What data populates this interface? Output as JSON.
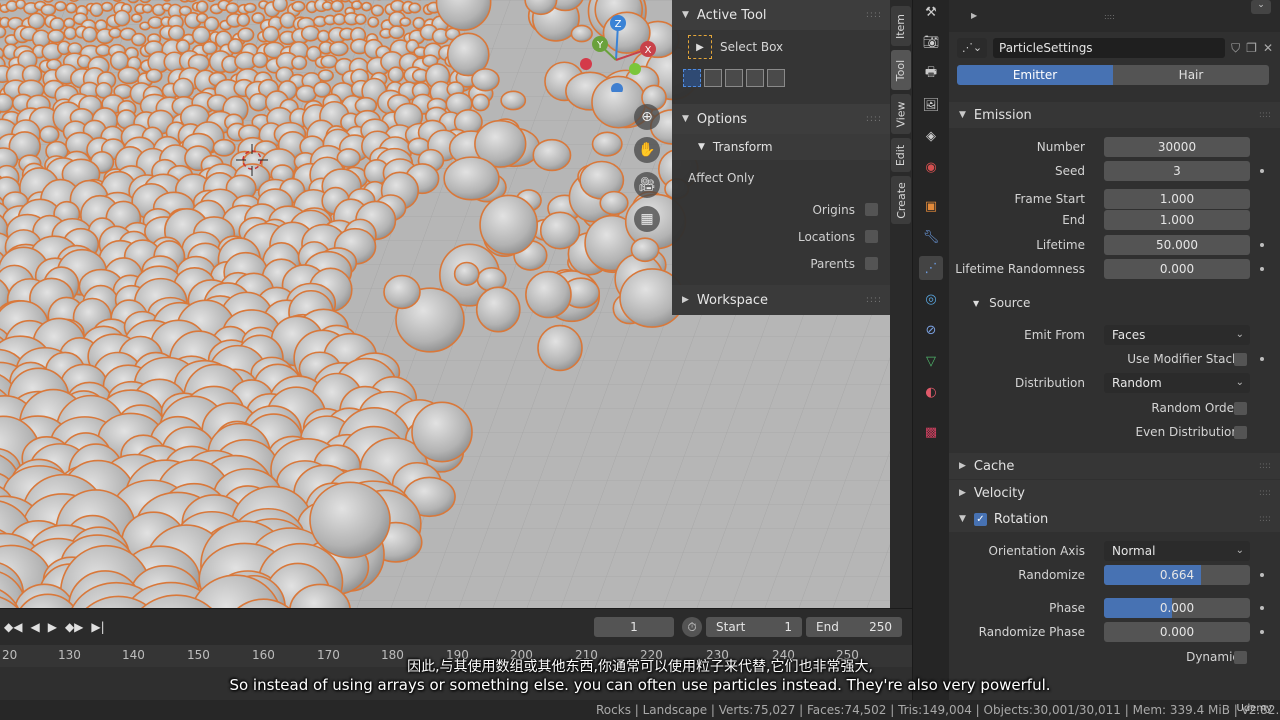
{
  "npanel": {
    "active_tool_title": "Active Tool",
    "tool_name": "Select Box",
    "options_title": "Options",
    "transform_title": "Transform",
    "affect_only": "Affect Only",
    "origins": "Origins",
    "locations": "Locations",
    "parents": "Parents",
    "workspace_title": "Workspace",
    "tabs": [
      "Item",
      "Tool",
      "View",
      "Edit",
      "Create"
    ]
  },
  "gizmo": {
    "z": "Z",
    "y": "Y",
    "x": "X"
  },
  "timeline": {
    "current_frame": "1",
    "start_label": "Start",
    "start_value": "1",
    "end_label": "End",
    "end_value": "250",
    "ruler": [
      "20",
      "130",
      "140",
      "150",
      "160",
      "170",
      "180",
      "190",
      "200",
      "210",
      "220",
      "230",
      "240",
      "250"
    ]
  },
  "props": {
    "settings_name": "ParticleSettings",
    "emitter": "Emitter",
    "hair": "Hair",
    "emission": {
      "title": "Emission",
      "number_label": "Number",
      "number": "30000",
      "seed_label": "Seed",
      "seed": "3",
      "frame_start_label": "Frame Start",
      "frame_start": "1.000",
      "end_label": "End",
      "end": "1.000",
      "lifetime_label": "Lifetime",
      "lifetime": "50.000",
      "lifetime_rand_label": "Lifetime Randomness",
      "lifetime_rand": "0.000"
    },
    "source": {
      "title": "Source",
      "emit_from_label": "Emit From",
      "emit_from": "Faces",
      "use_modifier_stack": "Use Modifier Stack",
      "distribution_label": "Distribution",
      "distribution": "Random",
      "random_order": "Random Order",
      "even_distribution": "Even Distribution"
    },
    "cache": "Cache",
    "velocity": "Velocity",
    "rotation": {
      "title": "Rotation",
      "orientation_axis_label": "Orientation Axis",
      "orientation_axis": "Normal",
      "randomize_label": "Randomize",
      "randomize": "0.664",
      "randomize_fraction": 0.664,
      "phase_label": "Phase",
      "phase": "0.000",
      "randomize_phase_label": "Randomize Phase",
      "randomize_phase": "0.000",
      "dynamic": "Dynamic"
    }
  },
  "status": {
    "text": "Rocks | Landscape | Verts:75,027 | Faces:74,502 | Tris:149,004 | Objects:30,001/30,011 | Mem: 339.4 MiB | v2.82.7",
    "brand": "Udemy"
  },
  "subtitles": {
    "cn": "因此,与其使用数组或其他东西,你通常可以使用粒子来代替,它们也非常强大,",
    "en": "So instead of using arrays or something else. you can often use particles instead. They're also very powerful."
  },
  "colors": {
    "accent": "#4772b3",
    "rock_outline": "#d9783a",
    "rock_fill": "#c8c8c8",
    "ground": "#b4b4b4"
  }
}
